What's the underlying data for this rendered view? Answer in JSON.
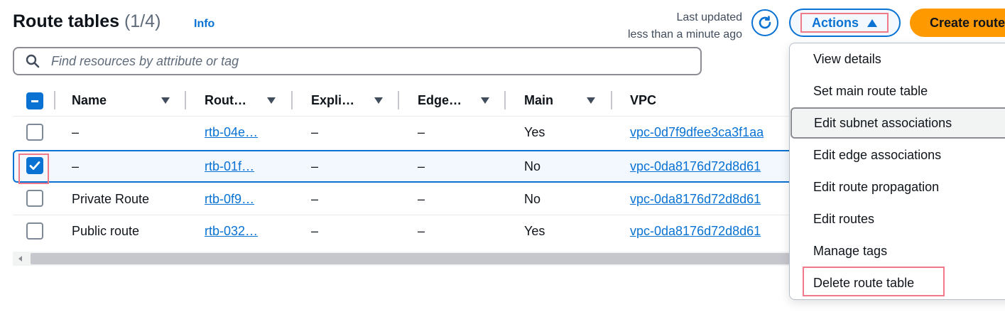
{
  "header": {
    "title": "Route tables",
    "count": "(1/4)",
    "info_label": "Info",
    "last_updated_label": "Last updated",
    "last_updated_value": "less than a minute ago",
    "actions_label": "Actions",
    "create_label": "Create route table"
  },
  "search": {
    "placeholder": "Find resources by attribute or tag"
  },
  "table": {
    "columns": [
      "Name",
      "Rout…",
      "Expli…",
      "Edge…",
      "Main",
      "VPC"
    ],
    "rows": [
      {
        "name": "–",
        "route_table_id": "rtb-04e…",
        "explicit": "–",
        "edge": "–",
        "main": "Yes",
        "vpc": "vpc-0d7f9dfee3ca3f1aa",
        "selected": false
      },
      {
        "name": "–",
        "route_table_id": "rtb-01f…",
        "explicit": "–",
        "edge": "–",
        "main": "No",
        "vpc": "vpc-0da8176d72d8d61",
        "selected": true
      },
      {
        "name": "Private Route",
        "route_table_id": "rtb-0f9…",
        "explicit": "–",
        "edge": "–",
        "main": "No",
        "vpc": "vpc-0da8176d72d8d61",
        "selected": false
      },
      {
        "name": "Public route",
        "route_table_id": "rtb-032…",
        "explicit": "–",
        "edge": "–",
        "main": "Yes",
        "vpc": "vpc-0da8176d72d8d61",
        "selected": false
      }
    ]
  },
  "actions_menu": {
    "items": [
      "View details",
      "Set main route table",
      "Edit subnet associations",
      "Edit edge associations",
      "Edit route propagation",
      "Edit routes",
      "Manage tags",
      "Delete route table"
    ],
    "hovered": "Edit subnet associations",
    "highlighted": "Delete route table"
  },
  "colors": {
    "accent": "#0972d3",
    "primary_button": "#ff9900",
    "annotation": "#f07a8a",
    "selected_row_bg": "#f2f8fd"
  },
  "icons": [
    "search-icon",
    "refresh-icon",
    "caret-up-icon",
    "sort-caret-icon",
    "checkbox-icon",
    "scroll-left-icon"
  ]
}
